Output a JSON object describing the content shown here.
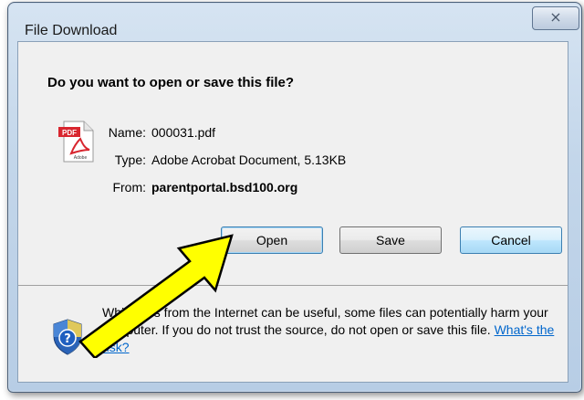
{
  "window": {
    "title": "File Download",
    "close_label": "⨯"
  },
  "dialog": {
    "question": "Do you want to open or save this file?",
    "file": {
      "name_label": "Name:",
      "name_value": "000031.pdf",
      "type_label": "Type:",
      "type_value": "Adobe Acrobat Document, 5.13KB",
      "from_label": "From:",
      "from_value": "parentportal.bsd100.org",
      "icon_text": "PDF",
      "icon_brand": "Adobe"
    },
    "buttons": {
      "open": "Open",
      "save": "Save",
      "cancel": "Cancel"
    },
    "warning": {
      "text": "While files from the Internet can be useful, some files can potentially harm your computer. If you do not trust the source, do not open or save this file.",
      "link": "What's the risk?"
    }
  },
  "colors": {
    "link": "#0066cc",
    "arrow_fill": "#ffff00",
    "pdf_red": "#d8262f",
    "shield_blue": "#2a63b8"
  },
  "icons": [
    "close-icon",
    "pdf-icon",
    "shield-icon",
    "arrow-annotation"
  ]
}
